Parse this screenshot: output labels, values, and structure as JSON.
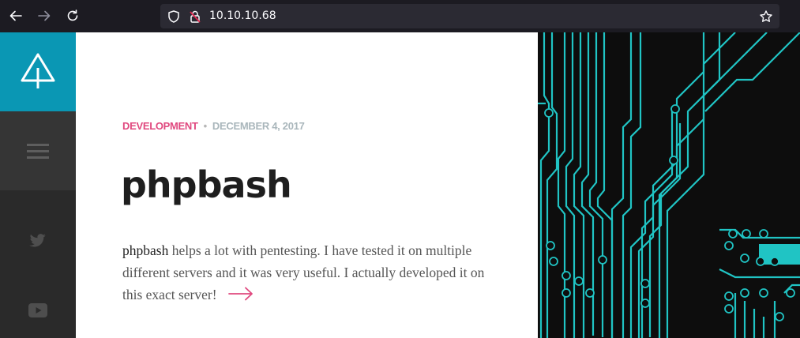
{
  "browser": {
    "url": "10.10.10.68",
    "icons": {
      "back": "arrow-left-icon",
      "forward": "arrow-right-icon",
      "reload": "reload-icon",
      "shield": "shield-icon",
      "insecure_lock": "insecure-lock-icon",
      "bookmark": "star-icon"
    }
  },
  "sidebar": {
    "logo_icon": "tree-logo-icon",
    "menu_icon": "hamburger-menu-icon",
    "social": [
      "twitter-icon",
      "youtube-icon"
    ],
    "colors": {
      "logo_bg": "#0a97b4",
      "menu_bg": "#353535",
      "bg": "#2a2a2a"
    }
  },
  "post": {
    "category": "DEVELOPMENT",
    "separator": "•",
    "date": "DECEMBER 4, 2017",
    "title": "phpbash",
    "excerpt_bold": "phpbash",
    "excerpt_rest": " helps a lot with pentesting. I have tested it on multiple different servers and it was very useful. I actually developed it on this exact server!",
    "read_more_icon": "arrow-right-icon",
    "colors": {
      "category": "#e0497f",
      "date": "#a9b6bb",
      "arrow": "#e0497f"
    }
  },
  "hero": {
    "image_icon": "circuit-board-image",
    "colors": {
      "bg": "#0d0d0d",
      "trace": "#20c4c4"
    }
  }
}
